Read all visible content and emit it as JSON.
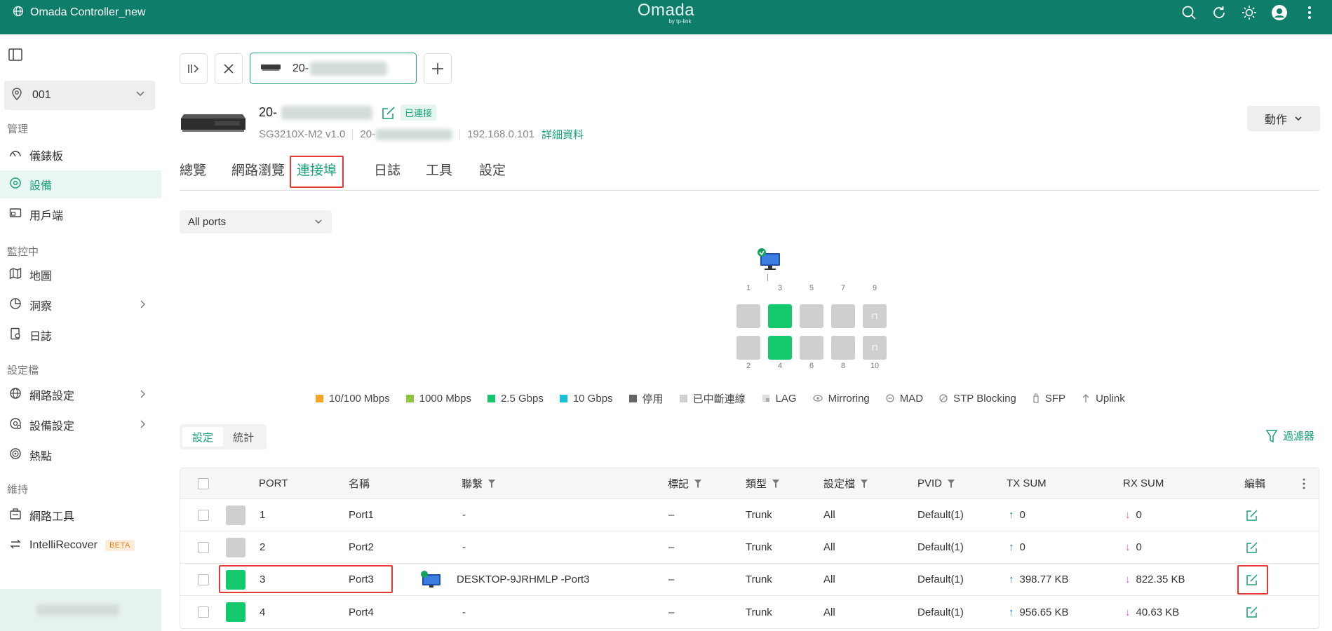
{
  "app": {
    "title": "Omada Controller_new",
    "logo_text": "Omada",
    "logo_sub": "by tp-link"
  },
  "topbar_icons": [
    "search-icon",
    "refresh-icon",
    "theme-icon",
    "avatar",
    "more-icon"
  ],
  "sidebar": {
    "site": "001",
    "sections": {
      "manage": "管理",
      "monitor": "監控中",
      "profiles": "設定檔",
      "maintain": "維持"
    },
    "items": [
      {
        "label": "儀錶板",
        "icon": "dashboard-icon"
      },
      {
        "label": "設備",
        "icon": "devices-icon",
        "active": true
      },
      {
        "label": "用戶端",
        "icon": "clients-icon"
      },
      {
        "label": "地圖",
        "icon": "map-icon"
      },
      {
        "label": "洞察",
        "icon": "insight-icon"
      },
      {
        "label": "日誌",
        "icon": "log-icon"
      },
      {
        "label": "網路設定",
        "icon": "network-icon"
      },
      {
        "label": "設備設定",
        "icon": "device-settings-icon"
      },
      {
        "label": "熱點",
        "icon": "hotspot-icon"
      },
      {
        "label": "網路工具",
        "icon": "tools-icon"
      },
      {
        "label": "IntelliRecover",
        "icon": "recover-icon",
        "badge": "BETA"
      }
    ]
  },
  "device_tab": {
    "name": "20-"
  },
  "device": {
    "name": "20-",
    "status": "已連接",
    "model": "SG3210X-M2 v1.0",
    "mac": "20-",
    "ip": "192.168.0.101",
    "details_link": "詳細資料",
    "action_button": "動作"
  },
  "tabs": [
    "總覽",
    "網路瀏覽",
    "連接埠",
    "日誌",
    "工具",
    "設定"
  ],
  "active_tab": "連接埠",
  "ports_filter": "All ports",
  "panel": {
    "top_numbers": [
      "1",
      "3",
      "5",
      "7",
      "9"
    ],
    "bottom_numbers": [
      "2",
      "4",
      "6",
      "8",
      "10"
    ],
    "connected_port": "3"
  },
  "legend": [
    {
      "label": "10/100 Mbps",
      "color": "#f5a623"
    },
    {
      "label": "1000 Mbps",
      "color": "#8cc63f"
    },
    {
      "label": "2.5 Gbps",
      "color": "#13c96b"
    },
    {
      "label": "10 Gbps",
      "color": "#16c1d8"
    },
    {
      "label": "停用",
      "color": "#666666"
    },
    {
      "label": "已中斷連線",
      "color": "#cfcfcf"
    },
    {
      "label": "LAG",
      "icon": "lag-icon"
    },
    {
      "label": "Mirroring",
      "icon": "mirroring-icon"
    },
    {
      "label": "MAD",
      "icon": "mad-icon"
    },
    {
      "label": "STP Blocking",
      "icon": "stp-icon"
    },
    {
      "label": "SFP",
      "icon": "sfp-icon"
    },
    {
      "label": "Uplink",
      "icon": "uplink-icon"
    }
  ],
  "view_toggle": {
    "settings": "設定",
    "stats": "統計"
  },
  "filter_label": "過濾器",
  "table": {
    "headers": {
      "port": "PORT",
      "name": "名稱",
      "link": "聯繫",
      "tag": "標記",
      "type": "類型",
      "profile": "設定檔",
      "pvid": "PVID",
      "tx": "TX SUM",
      "rx": "RX SUM",
      "edit": "編輯"
    },
    "rows": [
      {
        "port": "1",
        "name": "Port1",
        "link": "-",
        "tag": "–",
        "type": "Trunk",
        "profile": "All",
        "pvid": "Default(1)",
        "tx": "0",
        "rx": "0",
        "up": false
      },
      {
        "port": "2",
        "name": "Port2",
        "link": "-",
        "tag": "–",
        "type": "Trunk",
        "profile": "All",
        "pvid": "Default(1)",
        "tx": "0",
        "rx": "0",
        "up": false
      },
      {
        "port": "3",
        "name": "Port3",
        "link": "DESKTOP-9JRHMLP -Port3",
        "tag": "–",
        "type": "Trunk",
        "profile": "All",
        "pvid": "Default(1)",
        "tx": "398.77 KB",
        "rx": "822.35 KB",
        "up": true
      },
      {
        "port": "4",
        "name": "Port4",
        "link": "-",
        "tag": "–",
        "type": "Trunk",
        "profile": "All",
        "pvid": "Default(1)",
        "tx": "956.65 KB",
        "rx": "40.63 KB",
        "up": true
      }
    ]
  }
}
